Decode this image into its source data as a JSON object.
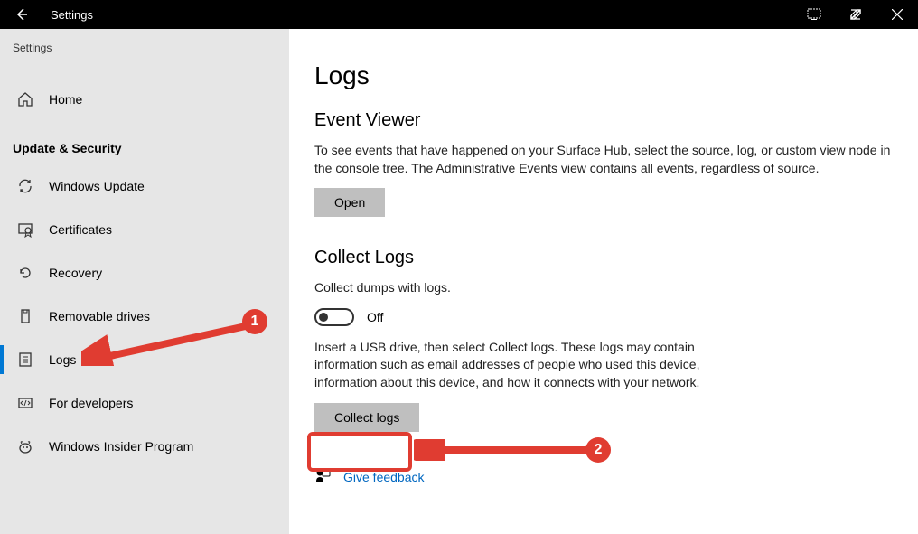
{
  "titlebar": {
    "title": "Settings"
  },
  "sidebar": {
    "crumb": "Settings",
    "home": "Home",
    "section": "Update & Security",
    "items": [
      {
        "label": "Windows Update"
      },
      {
        "label": "Certificates"
      },
      {
        "label": "Recovery"
      },
      {
        "label": "Removable drives"
      },
      {
        "label": "Logs"
      },
      {
        "label": "For developers"
      },
      {
        "label": "Windows Insider Program"
      }
    ]
  },
  "main": {
    "page_title": "Logs",
    "event_viewer": {
      "heading": "Event Viewer",
      "body": "To see events that have happened on your Surface Hub, select the source, log, or custom view node in the console tree. The Administrative Events view contains all events, regardless of source.",
      "open_btn": "Open"
    },
    "collect_logs": {
      "heading": "Collect Logs",
      "dumps_label": "Collect dumps with logs.",
      "toggle_state": "Off",
      "body": "Insert a USB drive, then select Collect logs. These logs may contain information such as email addresses of people who used this device, information about this device, and how it connects with your network.",
      "collect_btn": "Collect logs"
    },
    "feedback": "Give feedback"
  },
  "annotations": {
    "one": "1",
    "two": "2"
  }
}
